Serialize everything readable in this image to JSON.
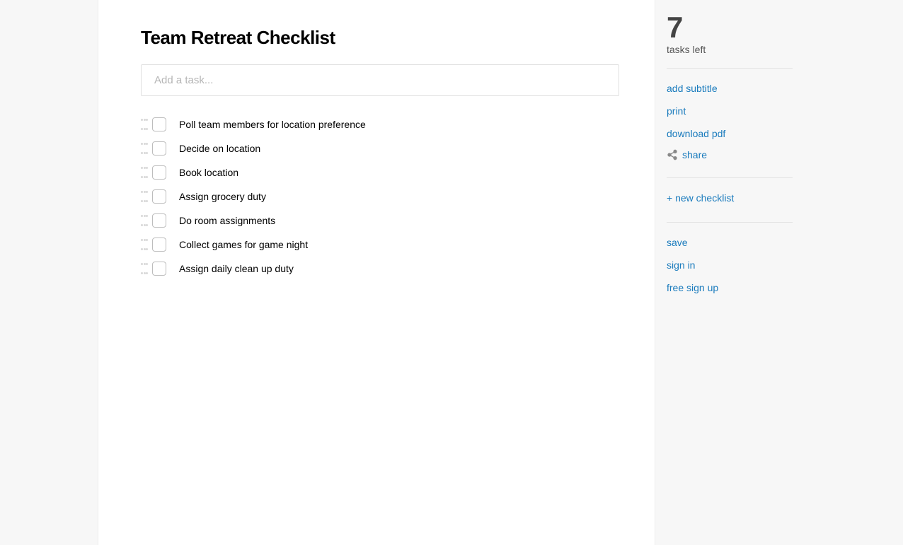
{
  "title": "Team Retreat Checklist",
  "add_task_placeholder": "Add a task...",
  "tasks": [
    {
      "text": "Poll team members for location preference"
    },
    {
      "text": "Decide on location"
    },
    {
      "text": "Book location"
    },
    {
      "text": "Assign grocery duty"
    },
    {
      "text": "Do room assignments"
    },
    {
      "text": "Collect games for game night"
    },
    {
      "text": "Assign daily clean up duty"
    }
  ],
  "sidebar": {
    "count": "7",
    "count_label": "tasks left",
    "add_subtitle": "add subtitle",
    "print": "print",
    "download_pdf": "download pdf",
    "share": "share",
    "new_checklist": "+ new checklist",
    "save": "save",
    "sign_in": "sign in",
    "free_sign_up": "free sign up"
  }
}
